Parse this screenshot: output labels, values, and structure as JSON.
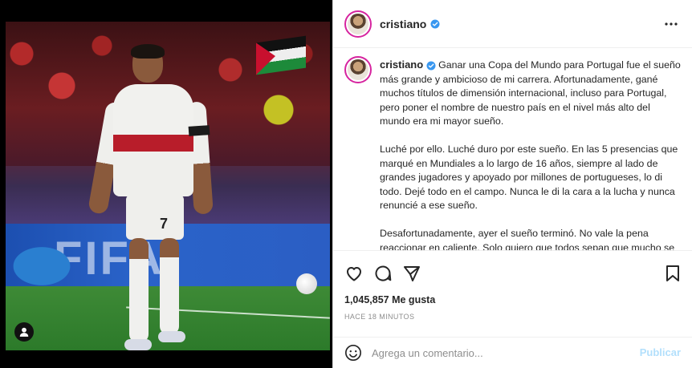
{
  "post": {
    "username": "cristiano",
    "verified": true,
    "caption_paragraphs": [
      "Ganar una Copa del Mundo para Portugal fue el sueño más grande y ambicioso de mi carrera. Afortunadamente, gané muchos títulos de dimensión internacional, incluso para Portugal, pero poner el nombre de nuestro país en el nivel más alto del mundo era mi mayor sueño.",
      "Luché por ello. Luché duro por este sueño. En las 5 presencias que marqué en Mundiales a lo largo de 16 años, siempre al lado de grandes jugadores y apoyado por millones de portugueses, lo di todo. Dejé todo en el campo. Nunca le di la cara a la lucha y nunca renuncié a ese sueño.",
      "Desafortunadamente, ayer el sueño terminó. No vale la pena reaccionar en caliente. Solo quiero que todos sepan que mucho se ha dicho, mucho se ha escrito, mucho se ha especulado, pero"
    ],
    "likes_count": "1,045,857",
    "likes_label": "Me gusta",
    "timestamp": "HACE 18 MINUTOS",
    "photo": {
      "board_text": "FIFA",
      "shorts_number": "7"
    }
  },
  "icons": {
    "more": "more-options-icon",
    "like": "heart-icon",
    "comment": "comment-icon",
    "share": "share-icon",
    "save": "bookmark-icon",
    "emoji": "emoji-icon",
    "user_tag": "tagged-user-icon",
    "verified": "verified-badge-icon"
  },
  "comment_box": {
    "placeholder": "Agrega un comentario...",
    "publish_label": "Publicar"
  },
  "colors": {
    "verified": "#3897f0",
    "publish_disabled": "#b2dffc",
    "text": "#262626",
    "muted": "#8e8e8e"
  }
}
